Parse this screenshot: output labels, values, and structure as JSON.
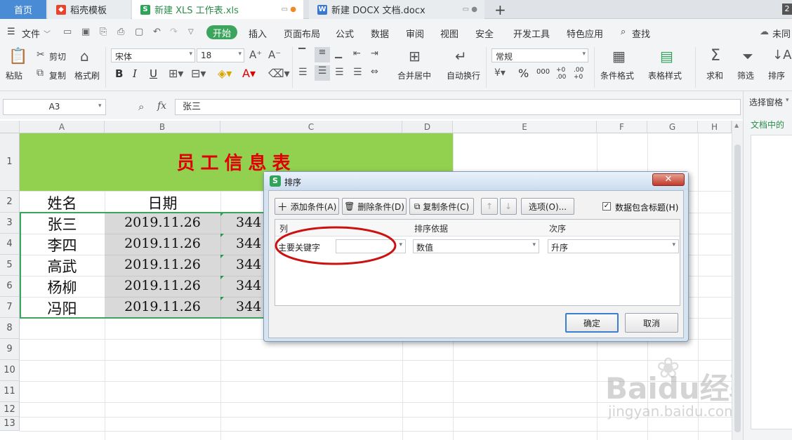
{
  "tabs": {
    "home": "首页",
    "daoke": "稻壳模板",
    "xls": "新建 XLS 工作表.xls",
    "docx": "新建 DOCX 文档.docx",
    "new_tab": "+",
    "count_badge": "2"
  },
  "menu": {
    "file": "文件",
    "start": "开始",
    "insert": "插入",
    "page_layout": "页面布局",
    "formula": "公式",
    "data": "数据",
    "review": "审阅",
    "view": "视图",
    "security": "安全",
    "dev_tools": "开发工具",
    "features": "特色应用",
    "search": "查找",
    "sync": "未同"
  },
  "ribbon": {
    "paste": "粘贴",
    "cut": "剪切",
    "copy": "复制",
    "format_painter": "格式刷",
    "font_name": "宋体",
    "font_size": "18",
    "merge_center": "合并居中",
    "wrap_text": "自动换行",
    "number_format": "常规",
    "cond_format": "条件格式",
    "table_style": "表格样式",
    "sum": "求和",
    "filter": "筛选",
    "sort": "排序",
    "bold": "B",
    "italic": "I",
    "underline": "U",
    "percent": "%",
    "thousands": "000",
    "inc_decimal": "+0 .00",
    "dec_decimal": ".00 +0"
  },
  "formula_bar": {
    "name_box": "A3",
    "fx": "fx",
    "content": "张三"
  },
  "side_panel": {
    "title": "选择窗格",
    "subtitle": "文档中的"
  },
  "sheet": {
    "columns": [
      "A",
      "B",
      "C",
      "D",
      "E",
      "F",
      "G",
      "H"
    ],
    "rows": [
      "1",
      "2",
      "3",
      "4",
      "5",
      "6",
      "7",
      "8",
      "9",
      "10",
      "11",
      "12",
      "13"
    ],
    "title": "员工信息表",
    "header_name": "姓名",
    "header_date": "日期",
    "names": [
      "张三",
      "李四",
      "高武",
      "杨柳",
      "冯阳"
    ],
    "dates": [
      "2019.11.26",
      "2019.11.26",
      "2019.11.26",
      "2019.11.26",
      "2019.11.26"
    ],
    "col_c_values": [
      "344",
      "344",
      "344",
      "344",
      "344"
    ]
  },
  "dialog": {
    "title": "排序",
    "add_condition": "添加条件(A)",
    "delete_condition": "删除条件(D)",
    "copy_condition": "复制条件(C)",
    "options": "选项(O)...",
    "has_header": "数据包含标题(H)",
    "has_header_checked": true,
    "col_header": "列",
    "basis_header": "排序依据",
    "order_header": "次序",
    "primary_key_label": "主要关键字",
    "primary_key_value": "",
    "basis_value": "数值",
    "order_value": "升序",
    "ok": "确定",
    "cancel": "取消"
  },
  "watermark": {
    "brand": "Baidu经验",
    "url": "jingyan.baidu.com"
  },
  "colors": {
    "title_fill": "#92d050",
    "title_text": "#e00000",
    "accent_green": "#3ba55d",
    "annotation_red": "#cc1111"
  }
}
